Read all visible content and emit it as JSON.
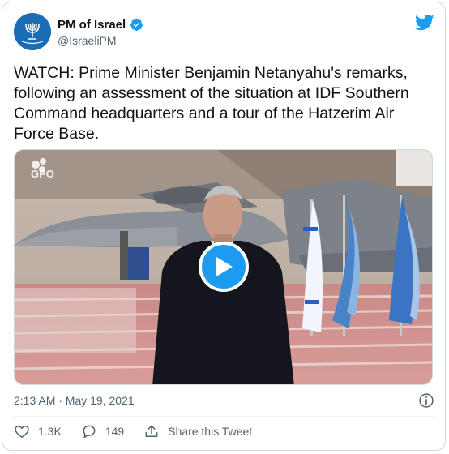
{
  "author": {
    "display_name": "PM of Israel",
    "handle": "@IsraeliPM"
  },
  "tweet": {
    "text": "WATCH: Prime Minister Benjamin Netanyahu's remarks, following an assessment of the situation at IDF Southern Command headquarters and a tour of the Hatzerim Air Force Base.",
    "timestamp": "2:13 AM · May 19, 2021"
  },
  "media": {
    "watermark": "GPO"
  },
  "actions": {
    "likes": "1.3K",
    "replies": "149",
    "share_label": "Share this Tweet"
  },
  "colors": {
    "accent": "#1d9bf0",
    "text_primary": "#0f1419",
    "text_secondary": "#536471",
    "border": "#cfd9de"
  },
  "icons": [
    "verified-icon",
    "twitter-bird-icon",
    "play-icon",
    "info-icon",
    "heart-icon",
    "reply-icon",
    "share-icon"
  ]
}
